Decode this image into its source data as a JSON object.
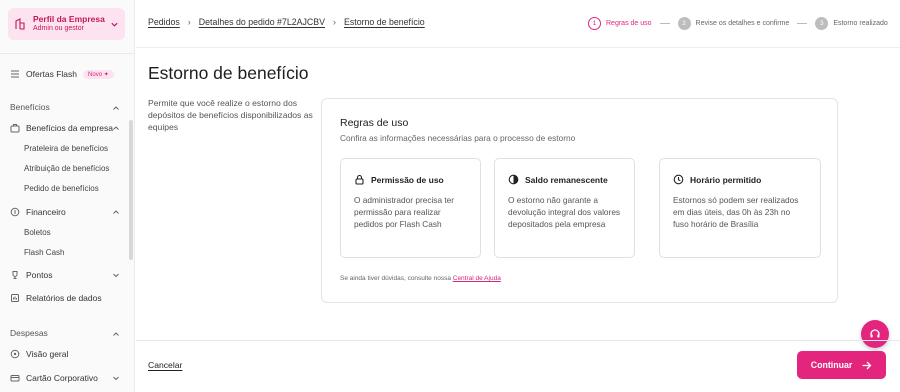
{
  "sidebar": {
    "profile": {
      "name": "Perfil da Empresa",
      "role": "Admin ou gestor"
    },
    "items": {
      "ofertas": {
        "label": "Ofertas Flash",
        "badge": "Novo ✦"
      },
      "beneficios_section": "Benefícios",
      "beneficios_empresa": "Benefícios da empresa",
      "prateleira": "Prateleira de benefícios",
      "atribuicao": "Atribuição de benefícios",
      "pedido": "Pedido de benefícios",
      "financeiro": "Financeiro",
      "boletos": "Boletos",
      "flash_cash": "Flash Cash",
      "pontos": "Pontos",
      "relatorios": "Relatórios de dados",
      "despesas_section": "Despesas",
      "visao_geral": "Visão geral",
      "cartao": "Cartão Corporativo"
    }
  },
  "breadcrumb": [
    "Pedidos",
    "Detalhes do pedido #7L2AJCBV",
    "Estorno de benefício"
  ],
  "steps": [
    {
      "num": "1",
      "label": "Regras de uso",
      "active": true
    },
    {
      "num": "2",
      "label": "Revise os detalhes e confirme",
      "active": false
    },
    {
      "num": "3",
      "label": "Estorno realizado",
      "active": false
    }
  ],
  "page": {
    "title": "Estorno de benefício",
    "description": "Permite que você realize o estorno dos depósitos de benefícios disponibilizados as equipes"
  },
  "card": {
    "title": "Regras de uso",
    "subtitle": "Confira as informações necessárias para o processo de estorno",
    "rules": [
      {
        "icon": "lock-icon",
        "title": "Permissão de uso",
        "text": "O administrador precisa ter permissão para realizar pedidos por Flash Cash"
      },
      {
        "icon": "half-circle-icon",
        "title": "Saldo remanescente",
        "text": "O estorno não garante a devolução integral dos valores depositados pela empresa"
      },
      {
        "icon": "clock-icon",
        "title": "Horário permitido",
        "text": "Estornos só podem ser realizados em dias úteis, das 0h às 23h no fuso horário de Brasília"
      }
    ],
    "help_prefix": "Se ainda tiver dúvidas, consulte nossa",
    "help_link": "Central de Ajuda"
  },
  "footer": {
    "cancel": "Cancelar",
    "continue": "Continuar"
  },
  "colors": {
    "accent": "#e4257e",
    "accent_light": "#fde3ef"
  }
}
